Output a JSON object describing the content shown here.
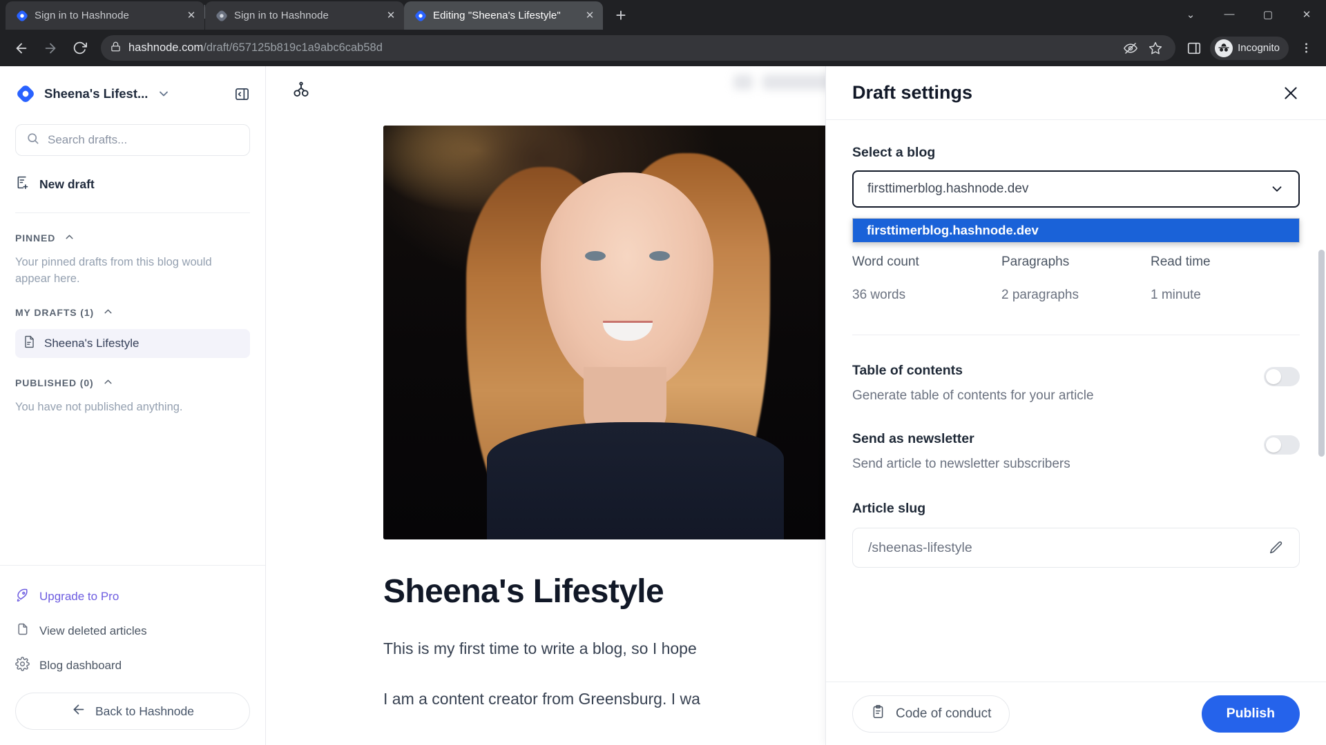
{
  "browser": {
    "tabs": [
      {
        "title": "Sign in to Hashnode",
        "favicon": "hashnode-icon",
        "active": false
      },
      {
        "title": "Sign in to Hashnode",
        "favicon": "hashnode-gray-icon",
        "active": false
      },
      {
        "title": "Editing \"Sheena's Lifestyle\"",
        "favicon": "hashnode-icon",
        "active": true
      }
    ],
    "new_tab_label": "+",
    "window_controls": {
      "list": "⌄",
      "minimize": "—",
      "maximize": "▢",
      "close": "✕"
    },
    "url_host": "hashnode.com",
    "url_path": "/draft/657125b819c1a9abc6cab58d",
    "profile_label": "Incognito"
  },
  "sidebar": {
    "blog_name": "Sheena's Lifest...",
    "search_placeholder": "Search drafts...",
    "new_draft_label": "New draft",
    "sections": [
      {
        "title": "PINNED",
        "empty_text": "Your pinned drafts from this blog would appear here."
      },
      {
        "title": "MY DRAFTS (1)",
        "items": [
          {
            "label": "Sheena's Lifestyle"
          }
        ]
      },
      {
        "title": "PUBLISHED (0)",
        "empty_text": "You have not published anything."
      }
    ],
    "footer_links": [
      {
        "label": "Upgrade to Pro",
        "icon": "rocket-icon"
      },
      {
        "label": "View deleted articles",
        "icon": "trash-file-icon"
      },
      {
        "label": "Blog dashboard",
        "icon": "gear-icon"
      }
    ],
    "back_label": "Back to Hashnode"
  },
  "editor": {
    "title": "Sheena's Lifestyle",
    "paragraph_1": "This is my first time to write a blog, so I hope",
    "paragraph_2": "I am a content creator from Greensburg. I wa"
  },
  "drawer": {
    "title": "Draft settings",
    "select_blog_label": "Select a blog",
    "selected_blog": "firsttimerblog.hashnode.dev",
    "blog_options": [
      "firsttimerblog.hashnode.dev"
    ],
    "stats": [
      {
        "key": "Word count",
        "value": "36 words"
      },
      {
        "key": "Paragraphs",
        "value": "2 paragraphs"
      },
      {
        "key": "Read time",
        "value": "1 minute"
      }
    ],
    "toggles": [
      {
        "title": "Table of contents",
        "subtitle": "Generate table of contents for your article",
        "on": false
      },
      {
        "title": "Send as newsletter",
        "subtitle": "Send article to newsletter subscribers",
        "on": false
      }
    ],
    "slug_label": "Article slug",
    "slug_value": "/sheenas-lifestyle",
    "code_of_conduct_label": "Code of conduct",
    "publish_label": "Publish"
  },
  "colors": {
    "accent_blue": "#2563eb",
    "highlight_blue": "#1a62d8",
    "pro_purple": "#6d5ce0",
    "chrome_dark": "#202124"
  }
}
